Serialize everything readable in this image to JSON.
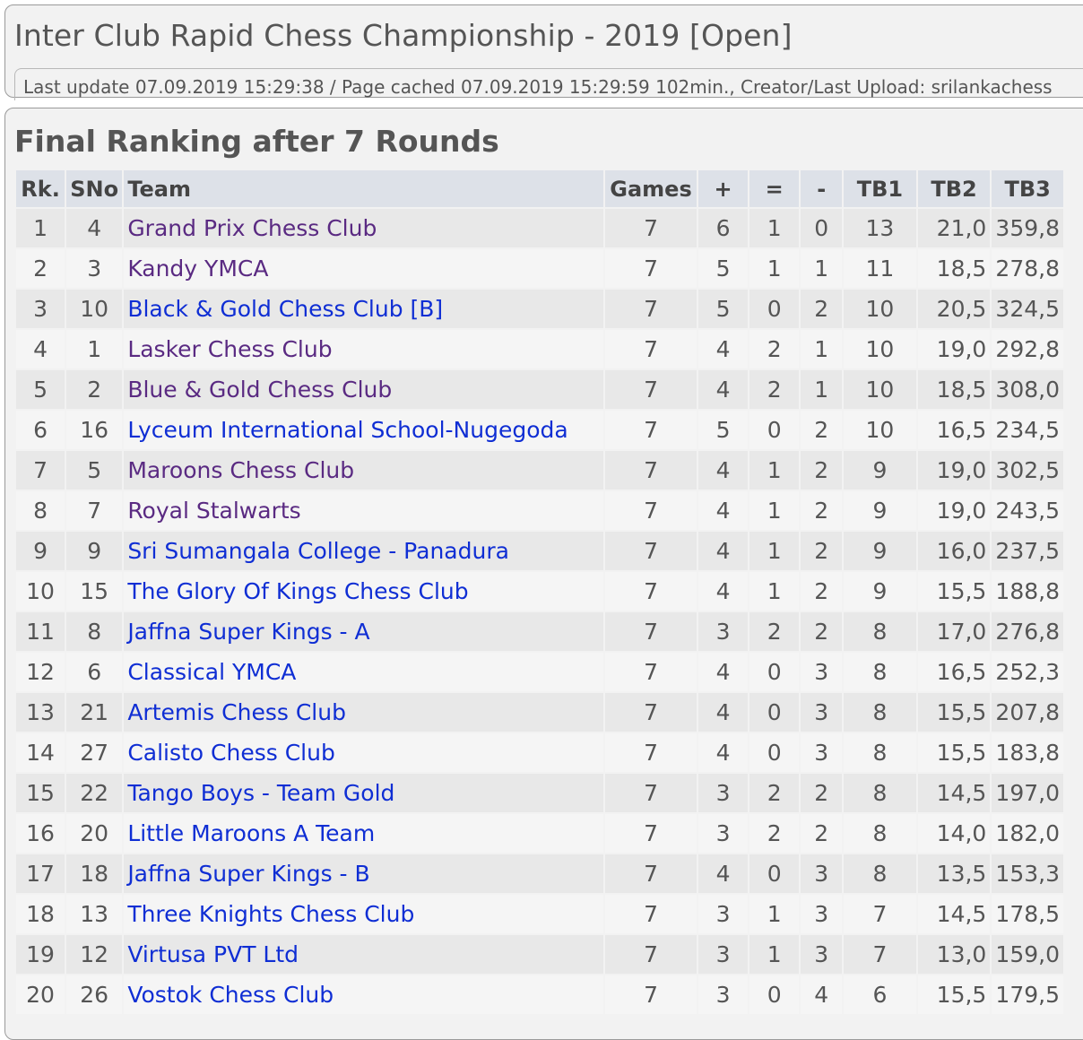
{
  "header": {
    "title": "Inter Club Rapid Chess Championship - 2019 [Open]",
    "meta": "Last update 07.09.2019 15:29:38 / Page cached 07.09.2019 15:29:59 102min., Creator/Last Upload: srilankachess"
  },
  "ranking": {
    "title": "Final Ranking after 7 Rounds",
    "columns": {
      "rank": "Rk.",
      "sno": "SNo",
      "team": "Team",
      "games": "Games",
      "won": "+",
      "drawn": "=",
      "lost": "-",
      "tb1": "TB1",
      "tb2": "TB2",
      "tb3": "TB3"
    },
    "rows": [
      {
        "rank": "1",
        "sno": "4",
        "team": "Grand Prix Chess Club",
        "games": "7",
        "won": "6",
        "drawn": "1",
        "lost": "0",
        "tb1": "13",
        "tb2": "21,0",
        "tb3": "359,8",
        "visited": true
      },
      {
        "rank": "2",
        "sno": "3",
        "team": "Kandy YMCA",
        "games": "7",
        "won": "5",
        "drawn": "1",
        "lost": "1",
        "tb1": "11",
        "tb2": "18,5",
        "tb3": "278,8",
        "visited": true
      },
      {
        "rank": "3",
        "sno": "10",
        "team": "Black & Gold Chess Club [B]",
        "games": "7",
        "won": "5",
        "drawn": "0",
        "lost": "2",
        "tb1": "10",
        "tb2": "20,5",
        "tb3": "324,5",
        "visited": false
      },
      {
        "rank": "4",
        "sno": "1",
        "team": "Lasker Chess Club",
        "games": "7",
        "won": "4",
        "drawn": "2",
        "lost": "1",
        "tb1": "10",
        "tb2": "19,0",
        "tb3": "292,8",
        "visited": true
      },
      {
        "rank": "5",
        "sno": "2",
        "team": "Blue & Gold Chess Club",
        "games": "7",
        "won": "4",
        "drawn": "2",
        "lost": "1",
        "tb1": "10",
        "tb2": "18,5",
        "tb3": "308,0",
        "visited": true
      },
      {
        "rank": "6",
        "sno": "16",
        "team": "Lyceum International School-Nugegoda",
        "games": "7",
        "won": "5",
        "drawn": "0",
        "lost": "2",
        "tb1": "10",
        "tb2": "16,5",
        "tb3": "234,5",
        "visited": false
      },
      {
        "rank": "7",
        "sno": "5",
        "team": "Maroons Chess Club",
        "games": "7",
        "won": "4",
        "drawn": "1",
        "lost": "2",
        "tb1": "9",
        "tb2": "19,0",
        "tb3": "302,5",
        "visited": true
      },
      {
        "rank": "8",
        "sno": "7",
        "team": "Royal Stalwarts",
        "games": "7",
        "won": "4",
        "drawn": "1",
        "lost": "2",
        "tb1": "9",
        "tb2": "19,0",
        "tb3": "243,5",
        "visited": true
      },
      {
        "rank": "9",
        "sno": "9",
        "team": "Sri Sumangala College - Panadura",
        "games": "7",
        "won": "4",
        "drawn": "1",
        "lost": "2",
        "tb1": "9",
        "tb2": "16,0",
        "tb3": "237,5",
        "visited": false
      },
      {
        "rank": "10",
        "sno": "15",
        "team": "The Glory Of Kings Chess Club",
        "games": "7",
        "won": "4",
        "drawn": "1",
        "lost": "2",
        "tb1": "9",
        "tb2": "15,5",
        "tb3": "188,8",
        "visited": false
      },
      {
        "rank": "11",
        "sno": "8",
        "team": "Jaffna Super Kings - A",
        "games": "7",
        "won": "3",
        "drawn": "2",
        "lost": "2",
        "tb1": "8",
        "tb2": "17,0",
        "tb3": "276,8",
        "visited": false
      },
      {
        "rank": "12",
        "sno": "6",
        "team": "Classical YMCA",
        "games": "7",
        "won": "4",
        "drawn": "0",
        "lost": "3",
        "tb1": "8",
        "tb2": "16,5",
        "tb3": "252,3",
        "visited": false
      },
      {
        "rank": "13",
        "sno": "21",
        "team": "Artemis Chess Club",
        "games": "7",
        "won": "4",
        "drawn": "0",
        "lost": "3",
        "tb1": "8",
        "tb2": "15,5",
        "tb3": "207,8",
        "visited": false
      },
      {
        "rank": "14",
        "sno": "27",
        "team": "Calisto Chess Club",
        "games": "7",
        "won": "4",
        "drawn": "0",
        "lost": "3",
        "tb1": "8",
        "tb2": "15,5",
        "tb3": "183,8",
        "visited": false
      },
      {
        "rank": "15",
        "sno": "22",
        "team": "Tango Boys - Team Gold",
        "games": "7",
        "won": "3",
        "drawn": "2",
        "lost": "2",
        "tb1": "8",
        "tb2": "14,5",
        "tb3": "197,0",
        "visited": false
      },
      {
        "rank": "16",
        "sno": "20",
        "team": "Little Maroons A Team",
        "games": "7",
        "won": "3",
        "drawn": "2",
        "lost": "2",
        "tb1": "8",
        "tb2": "14,0",
        "tb3": "182,0",
        "visited": false
      },
      {
        "rank": "17",
        "sno": "18",
        "team": "Jaffna Super Kings - B",
        "games": "7",
        "won": "4",
        "drawn": "0",
        "lost": "3",
        "tb1": "8",
        "tb2": "13,5",
        "tb3": "153,3",
        "visited": false
      },
      {
        "rank": "18",
        "sno": "13",
        "team": "Three Knights Chess Club",
        "games": "7",
        "won": "3",
        "drawn": "1",
        "lost": "3",
        "tb1": "7",
        "tb2": "14,5",
        "tb3": "178,5",
        "visited": false
      },
      {
        "rank": "19",
        "sno": "12",
        "team": "Virtusa PVT Ltd",
        "games": "7",
        "won": "3",
        "drawn": "1",
        "lost": "3",
        "tb1": "7",
        "tb2": "13,0",
        "tb3": "159,0",
        "visited": false
      },
      {
        "rank": "20",
        "sno": "26",
        "team": "Vostok Chess Club",
        "games": "7",
        "won": "3",
        "drawn": "0",
        "lost": "4",
        "tb1": "6",
        "tb2": "15,5",
        "tb3": "179,5",
        "visited": false
      }
    ]
  },
  "colors": {
    "link_visited": "#5a2a82",
    "link_unvisited": "#0f2ed4",
    "header_bg": "#dde1e8",
    "row_odd": "#e8e8e8",
    "row_even": "#f5f5f5",
    "text": "#555555"
  }
}
